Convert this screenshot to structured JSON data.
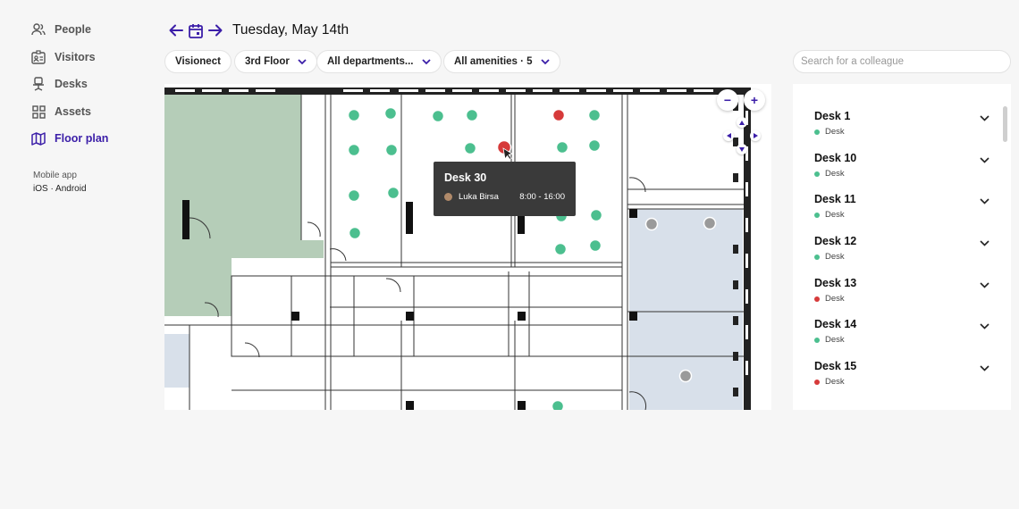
{
  "sidebar": {
    "items": [
      {
        "label": "People",
        "icon": "people-icon"
      },
      {
        "label": "Visitors",
        "icon": "visitor-badge-icon"
      },
      {
        "label": "Desks",
        "icon": "desk-chair-icon"
      },
      {
        "label": "Assets",
        "icon": "assets-grid-icon"
      },
      {
        "label": "Floor plan",
        "icon": "map-icon",
        "active": true
      }
    ],
    "mobile_app": {
      "title": "Mobile app",
      "ios": "iOS",
      "separator": "·",
      "android": "Android"
    }
  },
  "header": {
    "date": "Tuesday, May 14th"
  },
  "filters": {
    "location": "Visionect",
    "floor": "3rd Floor",
    "departments": "All departments...",
    "amenities": "All amenities · 5"
  },
  "search": {
    "placeholder": "Search for a colleague",
    "value": ""
  },
  "map_controls": {
    "zoom_out": "−",
    "zoom_in": "+"
  },
  "tooltip": {
    "title": "Desk 30",
    "person": "Luka Birsa",
    "time": "8:00 - 16:00"
  },
  "desk_list": [
    {
      "name": "Desk 1",
      "type": "Desk",
      "status": "available"
    },
    {
      "name": "Desk 10",
      "type": "Desk",
      "status": "available"
    },
    {
      "name": "Desk 11",
      "type": "Desk",
      "status": "available"
    },
    {
      "name": "Desk 12",
      "type": "Desk",
      "status": "available"
    },
    {
      "name": "Desk 13",
      "type": "Desk",
      "status": "booked"
    },
    {
      "name": "Desk 14",
      "type": "Desk",
      "status": "available"
    },
    {
      "name": "Desk 15",
      "type": "Desk",
      "status": "booked"
    }
  ],
  "colors": {
    "accent": "#3b1ea8",
    "available": "#4cbf8f",
    "booked": "#d63a3a",
    "disabled": "#9a9a9a",
    "room_green": "#b5cdb8",
    "room_blue": "#d8e0ea"
  }
}
